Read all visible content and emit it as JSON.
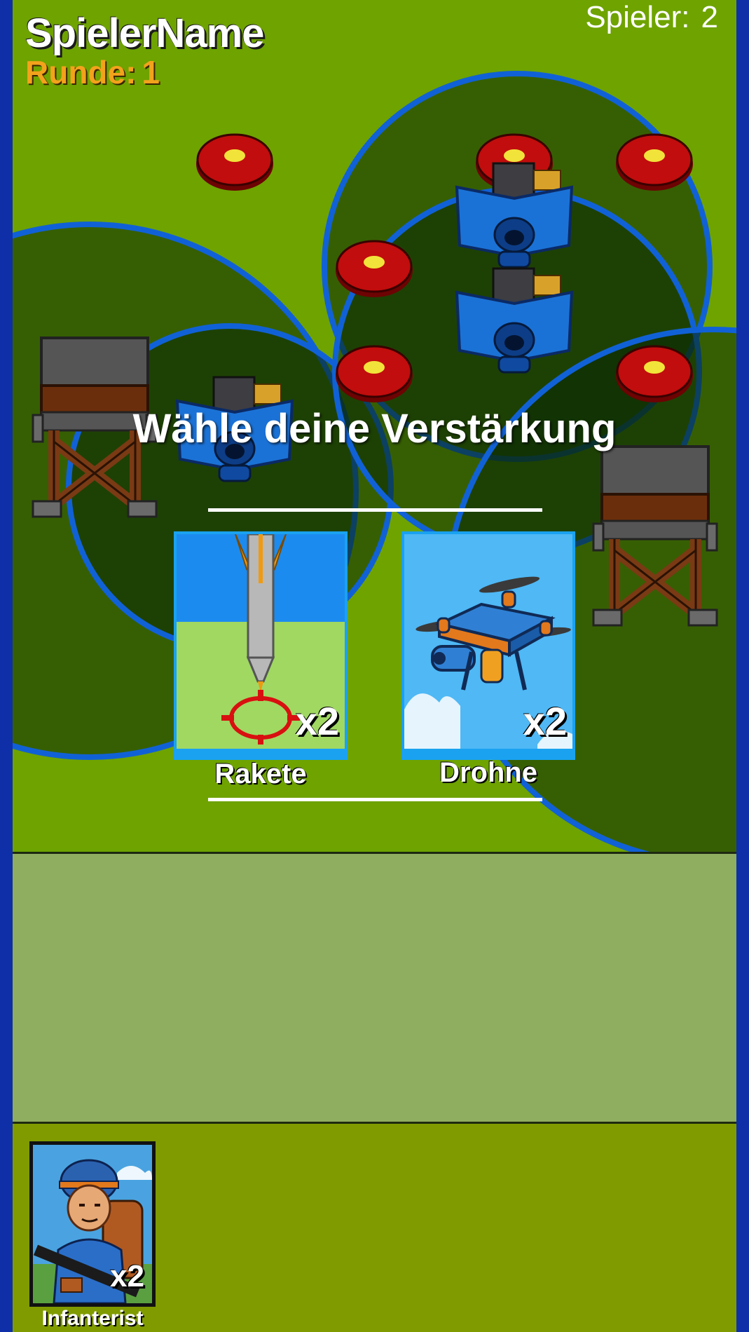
{
  "hud": {
    "player_name": "SpielerName",
    "round_label": "Runde:",
    "round_value": "1",
    "players_label": "Spieler:",
    "players_value": "2"
  },
  "dialog": {
    "title": "Wähle deine Verstärkung",
    "options": [
      {
        "label": "Rakete",
        "count": "x2",
        "icon": "missile-icon"
      },
      {
        "label": "Drohne",
        "count": "x2",
        "icon": "drone-icon"
      }
    ]
  },
  "hand": {
    "cards": [
      {
        "label": "Infanterist",
        "count": "x2",
        "icon": "soldier-icon"
      }
    ]
  },
  "colors": {
    "map_green": "#6ea300",
    "panel_green": "#8fae60",
    "hand_green": "#809b00",
    "card_blue": "#1aa2f0",
    "round_orange": "#f3a21c",
    "zone_blue": "#1161d6",
    "target_red": "#b80a0a"
  }
}
